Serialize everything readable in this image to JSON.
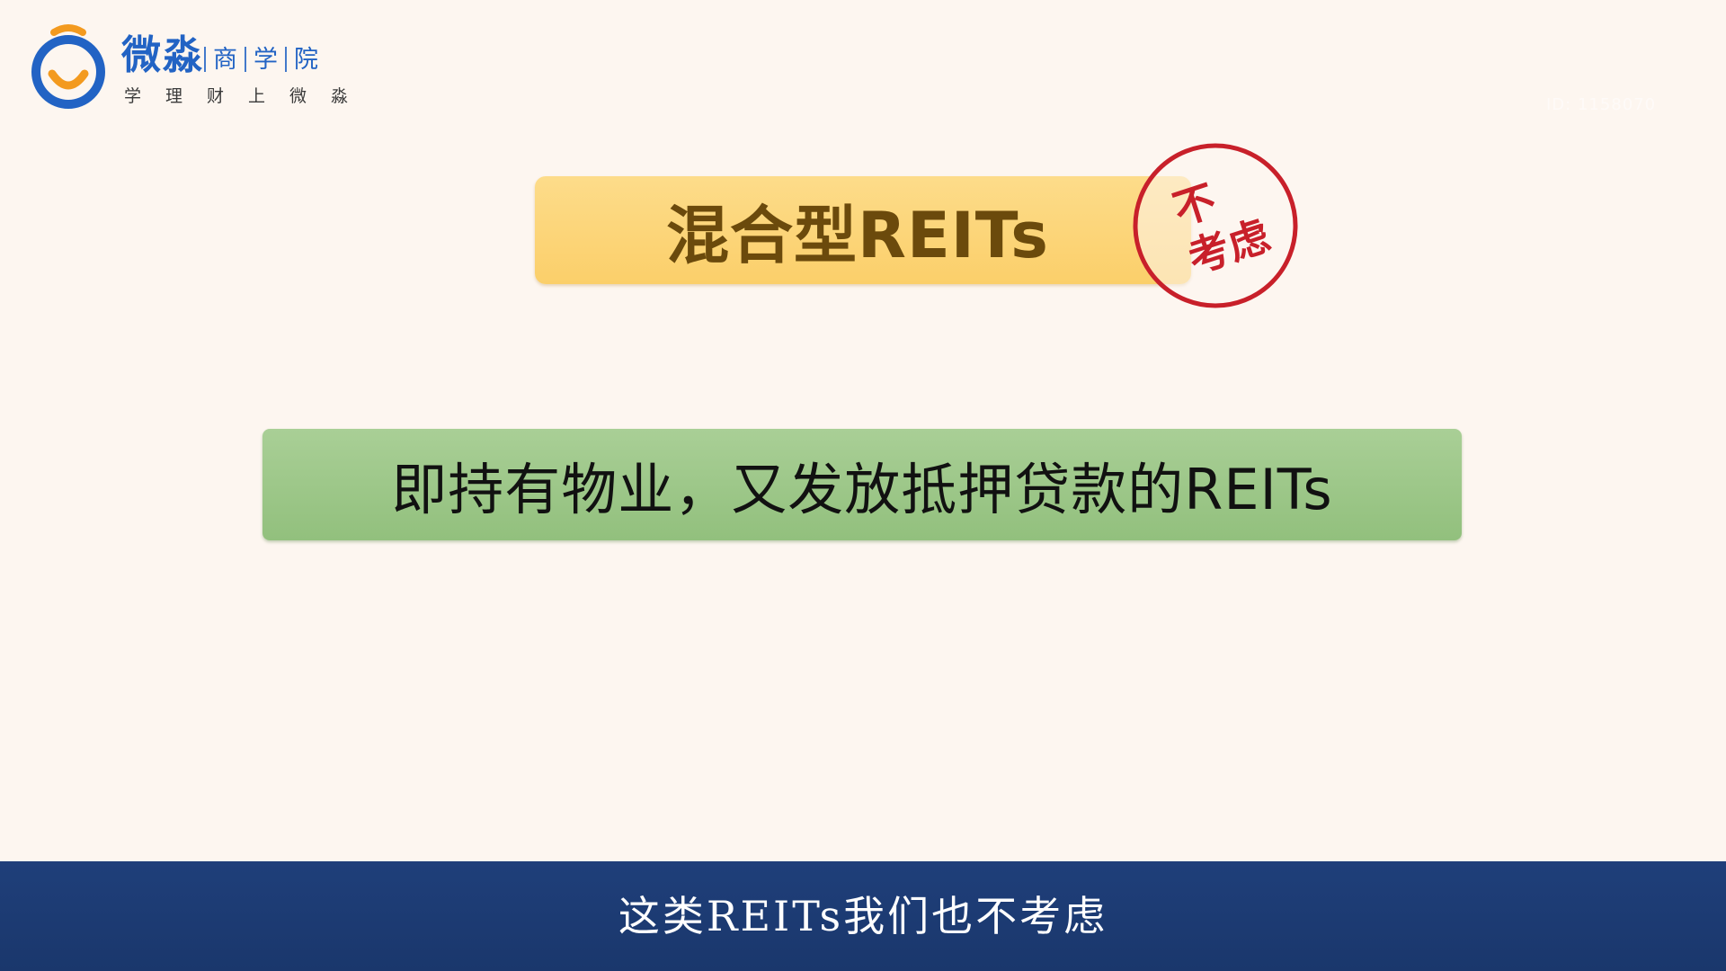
{
  "logo": {
    "name": "微淼",
    "subtitle_items": [
      "商",
      "学",
      "院"
    ],
    "slogan": [
      "学",
      "理",
      "财",
      "上",
      "微",
      "淼"
    ],
    "colors": {
      "blue": "#2263c4",
      "orange": "#f39a1f"
    }
  },
  "watermark": "ID: 1158070",
  "slide": {
    "title": "混合型REITs",
    "stamp_line1": "不",
    "stamp_line2": "考虑",
    "definition": "即持有物业，又发放抵押贷款的REITs"
  },
  "subtitle": "这类REITs我们也不考虑",
  "colors": {
    "background": "#fdf6f0",
    "title_box": "#fbcf6a",
    "title_text": "#6b4a0c",
    "stamp_red": "#c8202a",
    "definition_box": "#9fc98c",
    "subtitle_bar": "#1f3f7a"
  }
}
